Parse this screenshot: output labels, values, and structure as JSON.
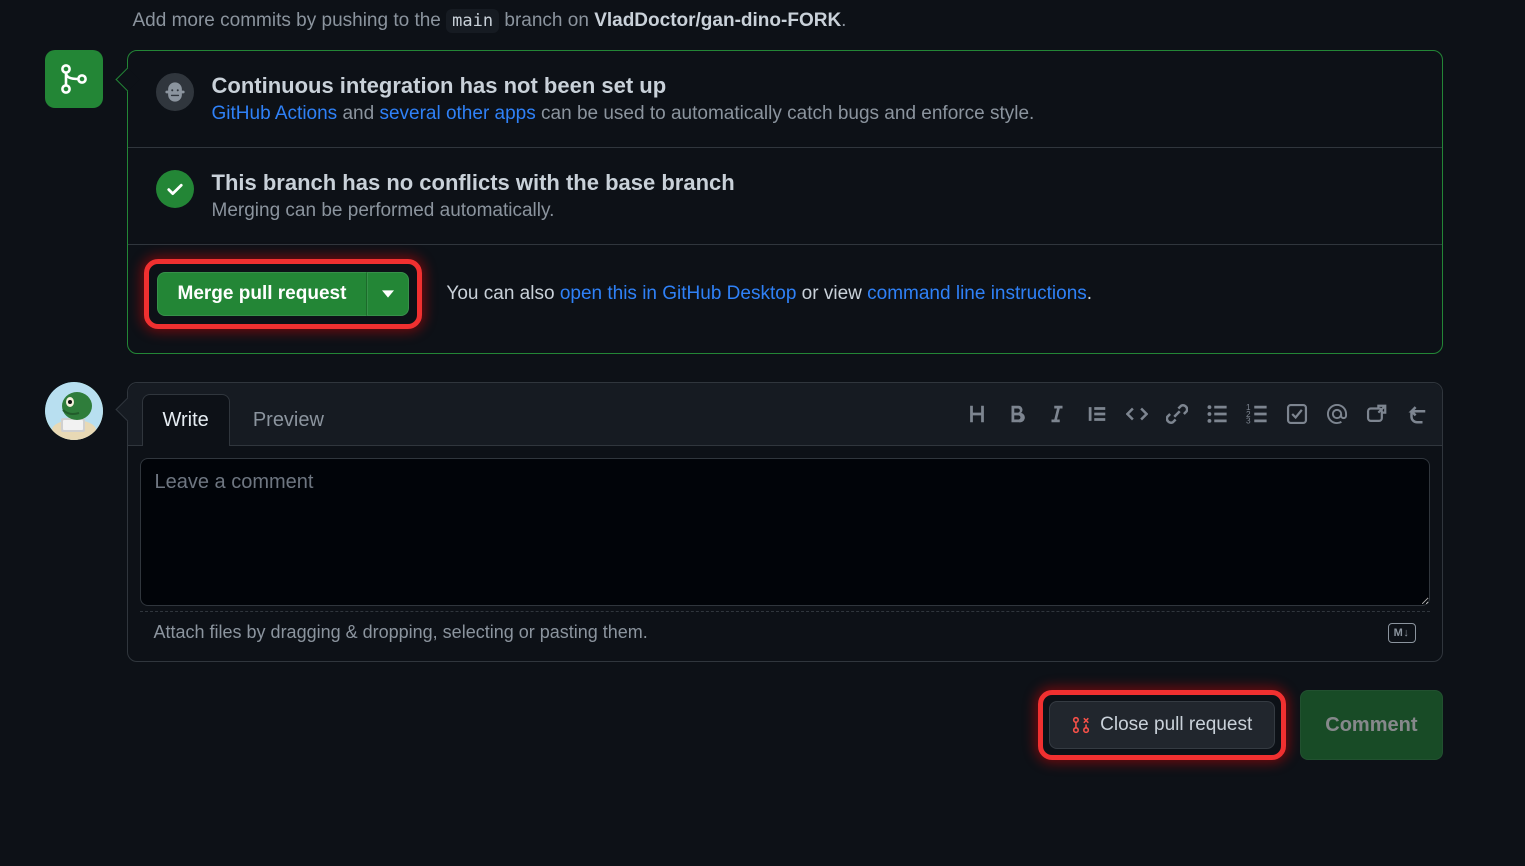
{
  "hint": {
    "prefix": "Add more commits by pushing to the ",
    "branch": "main",
    "mid": " branch on ",
    "repo": "VladDoctor/gan-dino-FORK",
    "suffix": "."
  },
  "ci": {
    "title": "Continuous integration has not been set up",
    "link1": "GitHub Actions",
    "mid": " and ",
    "link2": "several other apps",
    "rest": " can be used to automatically catch bugs and enforce style."
  },
  "conflicts": {
    "title": "This branch has no conflicts with the base branch",
    "sub": "Merging can be performed automatically."
  },
  "merge": {
    "button": "Merge pull request",
    "also_prefix": "You can also ",
    "desktop": "open this in GitHub Desktop",
    "or_view": " or view ",
    "cli": "command line instructions",
    "period": "."
  },
  "comment": {
    "tabs": {
      "write": "Write",
      "preview": "Preview"
    },
    "placeholder": "Leave a comment",
    "attach": "Attach files by dragging & dropping, selecting or pasting them.",
    "markdown_badge": "M↓"
  },
  "actions": {
    "close": "Close pull request",
    "comment": "Comment"
  }
}
